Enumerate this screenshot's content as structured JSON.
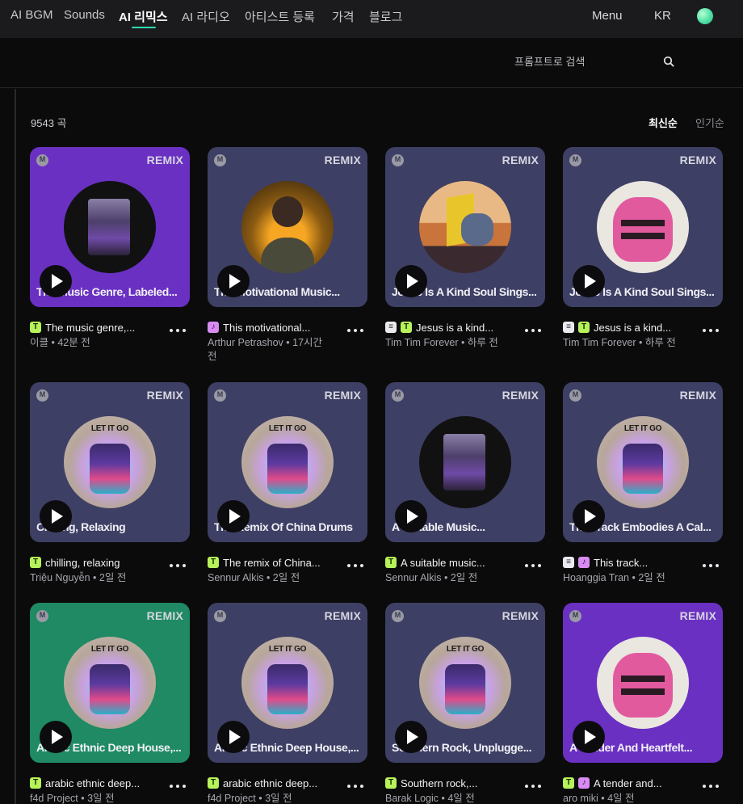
{
  "nav": {
    "items": [
      "AI BGM",
      "Sounds",
      "AI 리믹스",
      "AI 라디오",
      "아티스트 등록",
      "가격",
      "블로그"
    ],
    "active": "AI 리믹스",
    "menu_label": "Menu",
    "lang_label": "KR"
  },
  "search": {
    "placeholder": "프롬프트로 검색"
  },
  "list": {
    "count_label": "9543 곡",
    "sort": [
      "최신순",
      "인기순"
    ]
  },
  "cover_tag": "REMIX",
  "cards": [
    {
      "bg": "purple",
      "art": "robot",
      "cover_title": "The Music Genre, Labeled...",
      "badges": [
        "t"
      ],
      "title": "The music genre,...",
      "sub": "이클 • 42분 전"
    },
    {
      "bg": "slate",
      "art": "man",
      "cover_title": "The Motivational Music...",
      "badges": [
        "m"
      ],
      "title": "This motivational...",
      "sub": "Arthur Petrashov • 17시간 전"
    },
    {
      "bg": "slate",
      "art": "cube",
      "cover_title": "Jesus Is A Kind Soul Sings...",
      "badges": [
        "s",
        "t"
      ],
      "title": "Jesus is a kind...",
      "sub": "Tim Tim Forever • 하루 전"
    },
    {
      "bg": "slate",
      "art": "cat",
      "cover_title": "Jesus Is A Kind Soul Sings...",
      "badges": [
        "s",
        "t"
      ],
      "title": "Jesus is a kind...",
      "sub": "Tim Tim Forever • 하루 전"
    },
    {
      "bg": "slate",
      "art": "go",
      "cover_title": "Chilling, Relaxing",
      "badges": [
        "t"
      ],
      "title": "chilling, relaxing",
      "sub": "Triệu Nguyễn • 2일 전"
    },
    {
      "bg": "slate",
      "art": "go",
      "cover_title": "The Remix Of China Drums",
      "badges": [
        "t"
      ],
      "title": "The remix of China...",
      "sub": "Sennur Alkis • 2일 전"
    },
    {
      "bg": "slate",
      "art": "robot",
      "cover_title": "A Suitable Music...",
      "badges": [
        "t"
      ],
      "title": "A suitable music...",
      "sub": "Sennur Alkis • 2일 전"
    },
    {
      "bg": "slate",
      "art": "go",
      "cover_title": "The Track Embodies A Cal...",
      "badges": [
        "s",
        "m"
      ],
      "title": "This track...",
      "sub": "Hoanggia Tran • 2일 전"
    },
    {
      "bg": "green",
      "art": "go",
      "cover_title": "Arabic Ethnic Deep House,...",
      "badges": [
        "t"
      ],
      "title": "arabic ethnic deep...",
      "sub": "f4d Project • 3일 전"
    },
    {
      "bg": "slate",
      "art": "go",
      "cover_title": "Arabic Ethnic Deep House,...",
      "badges": [
        "t"
      ],
      "title": "arabic ethnic deep...",
      "sub": "f4d Project • 3일 전"
    },
    {
      "bg": "slate",
      "art": "go",
      "cover_title": "Southern Rock, Unplugge...",
      "badges": [
        "t"
      ],
      "title": "Southern rock,...",
      "sub": "Barak Logic • 4일 전"
    },
    {
      "bg": "purple",
      "art": "cat",
      "cover_title": "A Tender And Heartfelt...",
      "badges": [
        "t",
        "m"
      ],
      "title": "A tender and...",
      "sub": "aro miki • 4일 전"
    }
  ],
  "colors": {
    "accent": "#2fd9b4",
    "purple": "#6a30c2",
    "slate": "#3e3f64",
    "green": "#1f8a63"
  }
}
